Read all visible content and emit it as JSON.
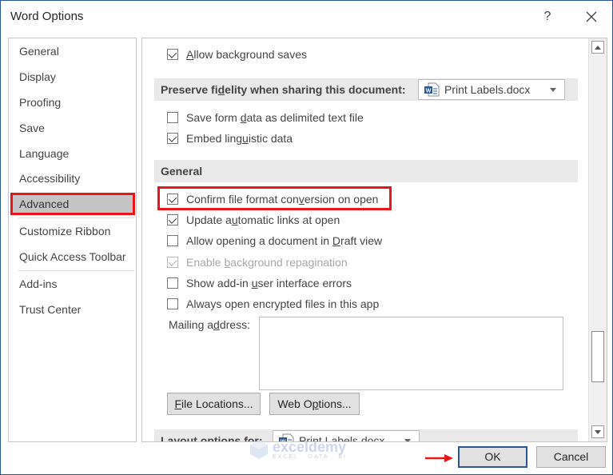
{
  "window": {
    "title": "Word Options",
    "help_label": "?",
    "close_label": "Close"
  },
  "sidebar": {
    "items": [
      {
        "label": "General"
      },
      {
        "label": "Display"
      },
      {
        "label": "Proofing"
      },
      {
        "label": "Save"
      },
      {
        "label": "Language"
      },
      {
        "label": "Accessibility"
      },
      {
        "label": "Advanced",
        "selected": true
      },
      {
        "label": "Customize Ribbon"
      },
      {
        "label": "Quick Access Toolbar"
      },
      {
        "label": "Add-ins"
      },
      {
        "label": "Trust Center"
      }
    ]
  },
  "main": {
    "allow_background_saves": {
      "pre": "",
      "u": "A",
      "post": "llow background saves",
      "checked": true
    },
    "preserve_fidelity": {
      "heading_pre": "Preserve fi",
      "heading_u": "d",
      "heading_post": "elity when sharing this document:",
      "document": "Print Labels.docx"
    },
    "fidelity_options": [
      {
        "pre": "Save form ",
        "u": "d",
        "post": "ata as delimited text file",
        "checked": false
      },
      {
        "pre": "Embed ling",
        "u": "u",
        "post": "istic data",
        "checked": true
      }
    ],
    "general": {
      "heading": "General",
      "options": [
        {
          "pre": "Confirm file format con",
          "u": "v",
          "post": "ersion on open",
          "checked": true,
          "highlighted": true
        },
        {
          "pre": "Update a",
          "u": "u",
          "post": "tomatic links at open",
          "checked": true
        },
        {
          "pre": "Allow opening a document in ",
          "u": "D",
          "post": "raft view",
          "checked": false
        },
        {
          "pre": "Enable ",
          "u": "b",
          "post": "ackground repagination",
          "checked": true,
          "disabled": true
        },
        {
          "pre": "Show add-in ",
          "u": "u",
          "post": "ser interface errors",
          "checked": false
        },
        {
          "pre": "Always open encrypted files in this app",
          "u": "",
          "post": "",
          "checked": false
        }
      ],
      "mailing_label_pre": "Mailing a",
      "mailing_label_u": "d",
      "mailing_label_post": "dress:",
      "mailing_value": "",
      "file_locations_u": "F",
      "file_locations_post": "ile Locations...",
      "web_options_pre": "Web O",
      "web_options_u": "p",
      "web_options_post": "tions..."
    },
    "layout_options": {
      "heading": "Layout options for:",
      "document": "Print Labels.docx"
    }
  },
  "footer": {
    "ok_label": "OK",
    "cancel_label": "Cancel"
  },
  "watermark": {
    "main": "exceldemy",
    "sub": "EXCEL · DATA · BI"
  },
  "colors": {
    "highlight_red": "#e8161b",
    "accent_blue": "#2b579a",
    "word_blue": "#2b5797"
  }
}
